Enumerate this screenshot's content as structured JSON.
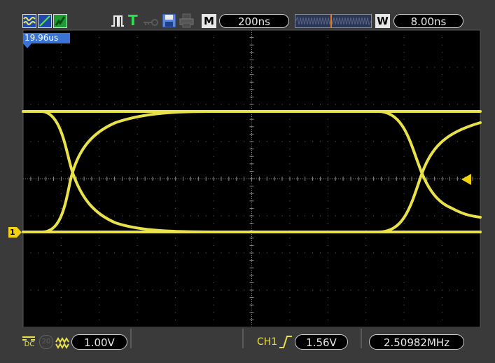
{
  "top_bar": {
    "timebase_label": "M",
    "timebase_value": "200ns",
    "window_label": "W",
    "window_value": "8.00ns",
    "trigger_t": "T"
  },
  "delay_marker": "19.96us",
  "bottom_bar": {
    "coupling_label": "DC",
    "bw_limit_label": "20",
    "channel_scale": "1.00V",
    "trigger_source": "CH1",
    "trigger_level": "1.56V",
    "frequency": "2.50982MHz"
  },
  "markers": {
    "channel1_label": "1"
  },
  "colors": {
    "trace": "#e8e14a",
    "trigger_marker": "#f1d20c",
    "grid": "#6b6b6b",
    "delay_tag": "#3a73d6",
    "accent_orange": "#e77d1b"
  },
  "icons": [
    "waveform-icon",
    "line-icon",
    "run-stop-icon",
    "pulse-icon",
    "trigger-t-icon",
    "key-icon",
    "save-icon",
    "print-icon"
  ]
}
